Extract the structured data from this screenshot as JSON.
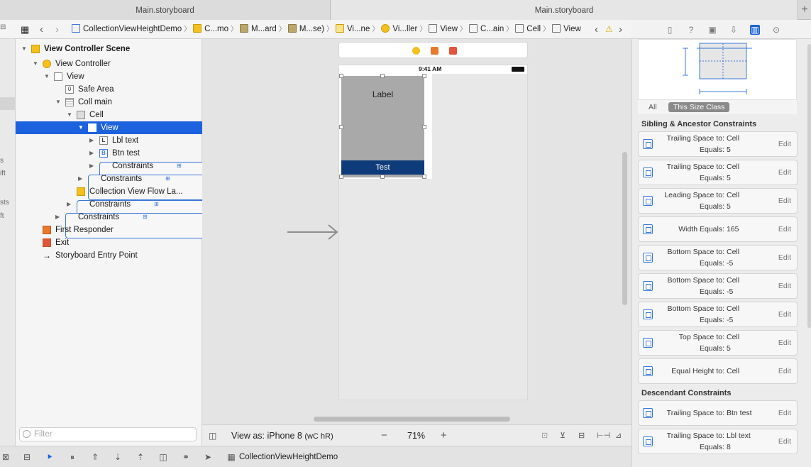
{
  "tabs": {
    "left": "Main.storyboard",
    "right": "Main.storyboard",
    "add": "+"
  },
  "jumpbar": {
    "items": [
      "CollectionViewHeightDemo",
      "C...mo",
      "M...ard",
      "M...se)",
      "Vi...ne",
      "Vi...ller",
      "View",
      "C...ain",
      "Cell",
      "View"
    ]
  },
  "left_strip": [
    "s",
    "ift",
    "sts",
    "ft"
  ],
  "outline": {
    "rows": [
      {
        "label": "View Controller Scene",
        "icon": "scene-icon"
      },
      {
        "label": "View Controller",
        "icon": "view-controller-icon"
      },
      {
        "label": "View",
        "icon": "view-icon"
      },
      {
        "label": "Safe Area",
        "icon": "safe-area-icon"
      },
      {
        "label": "Coll main",
        "icon": "collection-view-icon"
      },
      {
        "label": "Cell",
        "icon": "cell-icon"
      },
      {
        "label": "View",
        "icon": "view-icon"
      },
      {
        "label": "Lbl text",
        "icon": "label-icon"
      },
      {
        "label": "Btn test",
        "icon": "button-icon"
      },
      {
        "label": "Constraints",
        "icon": "constraints-icon"
      },
      {
        "label": "Constraints",
        "icon": "constraints-icon"
      },
      {
        "label": "Collection View Flow La...",
        "icon": "flow-layout-icon"
      },
      {
        "label": "Constraints",
        "icon": "constraints-icon"
      },
      {
        "label": "Constraints",
        "icon": "constraints-icon"
      },
      {
        "label": "First Responder",
        "icon": "first-responder-icon"
      },
      {
        "label": "Exit",
        "icon": "exit-icon"
      },
      {
        "label": "Storyboard Entry Point",
        "icon": "entry-point-icon"
      }
    ],
    "selected_row": "View",
    "filter_placeholder": "Filter"
  },
  "canvas": {
    "status_time": "9:41 AM",
    "cell_label": "Label",
    "cell_button": "Test",
    "view_as": "View as: iPhone 8",
    "size_class": "(wC hR)",
    "zoom": "71%",
    "zoom_out": "−",
    "zoom_in": "+"
  },
  "bottom_bar": {
    "scheme": "CollectionViewHeightDemo"
  },
  "inspector": {
    "size_class_all": "All",
    "size_class_this": "This Size Class",
    "section_sibling": "Sibling & Ancestor Constraints",
    "section_descendant": "Descendant Constraints",
    "edit_label": "Edit",
    "constraints": [
      {
        "k1": "Trailing Space to:",
        "v1": "Cell",
        "k2": "Equals:",
        "v2": "5"
      },
      {
        "k1": "Trailing Space to:",
        "v1": "Cell",
        "k2": "Equals:",
        "v2": "5"
      },
      {
        "k1": "Leading Space to:",
        "v1": "Cell",
        "k2": "Equals:",
        "v2": "5"
      },
      {
        "k1": "Width Equals:",
        "v1": "165"
      },
      {
        "k1": "Bottom Space to:",
        "v1": "Cell",
        "k2": "Equals:",
        "v2": "-5"
      },
      {
        "k1": "Bottom Space to:",
        "v1": "Cell",
        "k2": "Equals:",
        "v2": "-5"
      },
      {
        "k1": "Bottom Space to:",
        "v1": "Cell",
        "k2": "Equals:",
        "v2": "-5"
      },
      {
        "k1": "Top Space to:",
        "v1": "Cell",
        "k2": "Equals:",
        "v2": "5"
      },
      {
        "k1": "Equal Height to:",
        "v1": "Cell"
      }
    ],
    "descendant": [
      {
        "k1": "Trailing Space to:",
        "v1": "Btn test"
      },
      {
        "k1": "Trailing Space to:",
        "v1": "Lbl text",
        "k2": "Equals:",
        "v2": "8"
      }
    ]
  },
  "colors": {
    "selection": "#1c62de",
    "button_fill": "#0e3b7a",
    "accent": "#3b78d8"
  }
}
